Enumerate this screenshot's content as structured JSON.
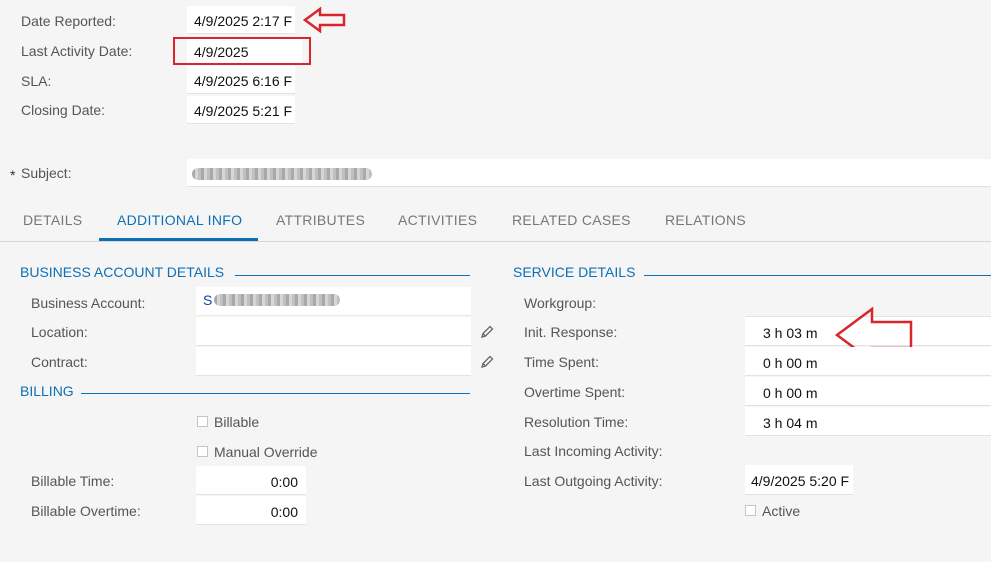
{
  "header": {
    "date_reported_label": "Date Reported:",
    "date_reported_value": "4/9/2025 2:17 F",
    "last_activity_label": "Last Activity Date:",
    "last_activity_value": "4/9/2025",
    "sla_label": "SLA:",
    "sla_value": "4/9/2025 6:16 F",
    "closing_label": "Closing Date:",
    "closing_value": "4/9/2025 5:21 F",
    "subject_required": "*",
    "subject_label": "Subject:"
  },
  "tabs": [
    {
      "label": "DETAILS"
    },
    {
      "label": "ADDITIONAL INFO"
    },
    {
      "label": "ATTRIBUTES"
    },
    {
      "label": "ACTIVITIES"
    },
    {
      "label": "RELATED CASES"
    },
    {
      "label": "RELATIONS"
    }
  ],
  "business": {
    "title": "BUSINESS ACCOUNT DETAILS",
    "account_label": "Business Account:",
    "account_value_prefix": "S",
    "location_label": "Location:",
    "contract_label": "Contract:"
  },
  "billing": {
    "title": "BILLING",
    "billable_label": "Billable",
    "manual_override_label": "Manual Override",
    "billable_time_label": "Billable Time:",
    "billable_time_value": "0:00",
    "billable_overtime_label": "Billable Overtime:",
    "billable_overtime_value": "0:00"
  },
  "service": {
    "title": "SERVICE DETAILS",
    "workgroup_label": "Workgroup:",
    "init_response_label": "Init. Response:",
    "init_response_value": "3 h 03 m",
    "time_spent_label": "Time Spent:",
    "time_spent_value": "0 h 00 m",
    "overtime_spent_label": "Overtime Spent:",
    "overtime_spent_value": "0 h 00 m",
    "resolution_time_label": "Resolution Time:",
    "resolution_time_value": "3 h 04 m",
    "last_incoming_label": "Last Incoming Activity:",
    "last_outgoing_label": "Last Outgoing Activity:",
    "last_outgoing_value": "4/9/2025 5:20 F",
    "active_label": "Active"
  },
  "annotations": {
    "color": "#d8262c",
    "icons": [
      "pencil-icon",
      "arrow-left-annotation"
    ]
  }
}
